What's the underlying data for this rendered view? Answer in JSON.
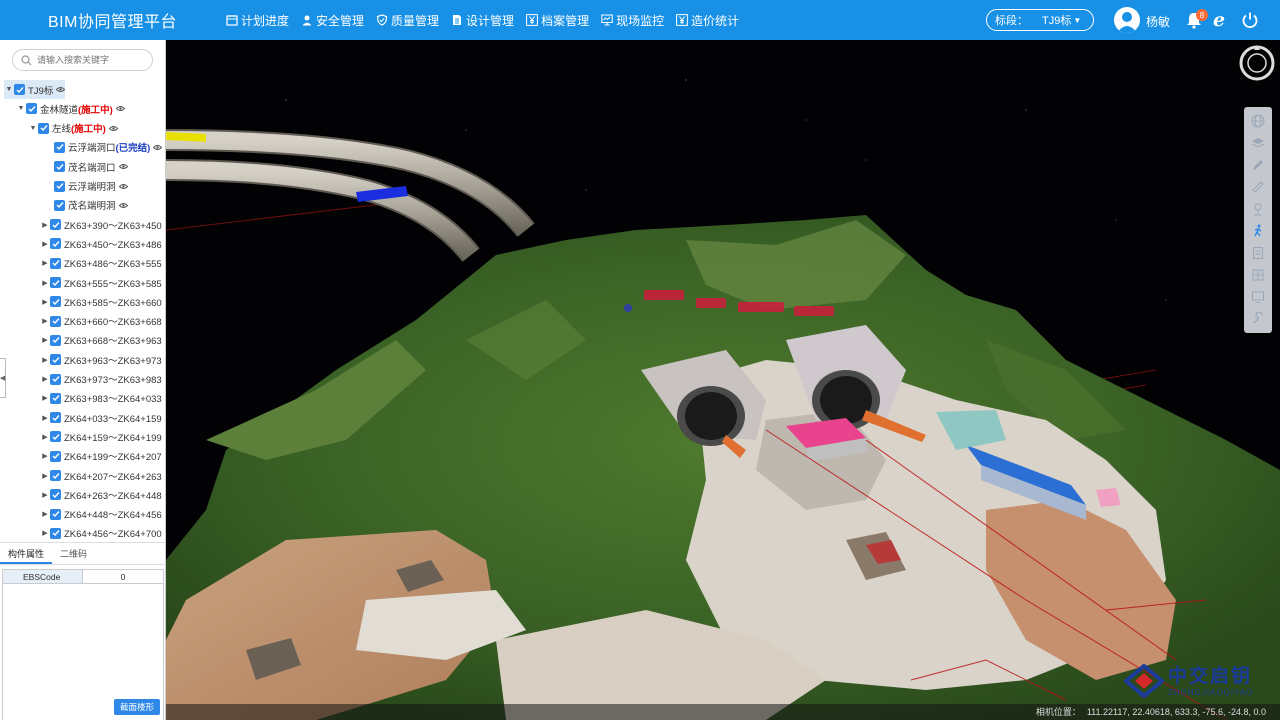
{
  "app": {
    "title": "BIM协同管理平台"
  },
  "nav": [
    {
      "label": "计划进度",
      "icon": "calendar-icon"
    },
    {
      "label": "安全管理",
      "icon": "user-safety-icon"
    },
    {
      "label": "质量管理",
      "icon": "shield-icon"
    },
    {
      "label": "设计管理",
      "icon": "document-icon"
    },
    {
      "label": "档案管理",
      "icon": "yen-icon"
    },
    {
      "label": "现场监控",
      "icon": "monitor-icon"
    },
    {
      "label": "造价统计",
      "icon": "yen-icon"
    }
  ],
  "section_select": {
    "label": "标段：",
    "value": "TJ9标"
  },
  "user": {
    "name": "杨敏",
    "notifications": "8"
  },
  "search": {
    "placeholder": "请输入搜索关键字"
  },
  "tree": {
    "root": "TJ9标",
    "tunnel": {
      "name": "金林隧道",
      "status": "(施工中)"
    },
    "line": {
      "name": "左线",
      "status": "(施工中)"
    },
    "leaf_1": {
      "name": "云浮端洞口",
      "status": "(已完结)"
    },
    "leaf_2": "茂名端洞口",
    "leaf_3": "云浮端明洞",
    "leaf_4": "茂名端明洞",
    "segments": [
      "ZK63+390～ZK63+450",
      "ZK63+450～ZK63+486",
      "ZK63+486～ZK63+555",
      "ZK63+555～ZK63+585",
      "ZK63+585～ZK63+660",
      "ZK63+660～ZK63+668",
      "ZK63+668～ZK63+963",
      "ZK63+963～ZK63+973",
      "ZK63+973～ZK63+983",
      "ZK63+983～ZK64+033",
      "ZK64+033～ZK64+159",
      "ZK64+159～ZK64+199",
      "ZK64+199～ZK64+207",
      "ZK64+207～ZK64+263",
      "ZK64+263～ZK64+448",
      "ZK64+448～ZK64+456",
      "ZK64+456～ZK64+700"
    ]
  },
  "properties": {
    "tabs": [
      "构件属性",
      "二维码"
    ],
    "rows": [
      {
        "key": "EBSCode",
        "value": "0"
      }
    ],
    "locate_button": "截面楼形"
  },
  "viewport": {
    "coord_label": "相机位置：",
    "coord_value": "111.22117, 22.40618, 633.3, -75.6, -24.8, 0.0"
  },
  "logo": {
    "cn": "中交启钥",
    "en": "ZHONGJIAOQIYAO"
  },
  "colors": {
    "topbar": "#1790e6",
    "accent": "#2f88e8",
    "status_active": "#e60000",
    "status_done": "#1a3fbf"
  }
}
